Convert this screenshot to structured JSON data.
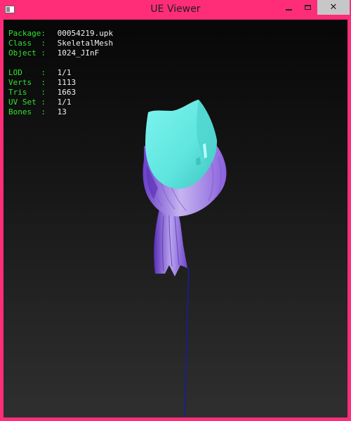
{
  "window": {
    "title": "UE Viewer",
    "icon": "app-icon",
    "controls": {
      "minimize": "minimize-icon",
      "maximize": "maximize-icon",
      "close": "close-icon",
      "close_glyph": "✕"
    }
  },
  "info": {
    "package": {
      "label": "Package:",
      "value": "00054219.upk"
    },
    "class": {
      "label": "Class  :",
      "value": "SkeletalMesh"
    },
    "object": {
      "label": "Object :",
      "value": "1024_JInF"
    },
    "lod": {
      "label": "LOD    :",
      "value": "1/1"
    },
    "verts": {
      "label": "Verts  :",
      "value": "1113"
    },
    "tris": {
      "label": "Tris   :",
      "value": "1663"
    },
    "uvset": {
      "label": "UV Set :",
      "value": "1/1"
    },
    "bones": {
      "label": "Bones  :",
      "value": "13"
    }
  },
  "colors": {
    "window_border": "#ff2d78",
    "label": "#2fe32f",
    "value": "#f2f2f2",
    "mesh_cap": "#5fe6e0",
    "mesh_hair": "#a98ae6",
    "bone_line": "#1a1aa0"
  }
}
